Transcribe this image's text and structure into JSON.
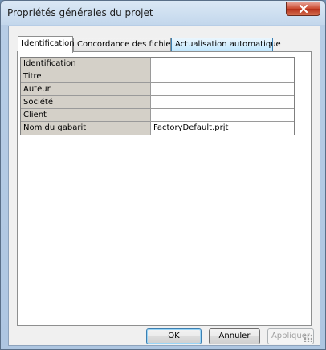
{
  "window": {
    "title": "Propriétés générales du projet"
  },
  "tabs": [
    {
      "label": "Identification",
      "state": "active"
    },
    {
      "label": "Concordance des fichiers",
      "state": "normal"
    },
    {
      "label": "Actualisation automatique",
      "state": "hover"
    }
  ],
  "properties": [
    {
      "name": "Identification",
      "value": ""
    },
    {
      "name": "Titre",
      "value": ""
    },
    {
      "name": "Auteur",
      "value": ""
    },
    {
      "name": "Société",
      "value": ""
    },
    {
      "name": "Client",
      "value": ""
    },
    {
      "name": "Nom du gabarit",
      "value": "FactoryDefault.prjt"
    }
  ],
  "buttons": {
    "ok": "OK",
    "cancel": "Annuler",
    "apply": "Appliquer"
  },
  "icons": {
    "close": "close-icon"
  }
}
